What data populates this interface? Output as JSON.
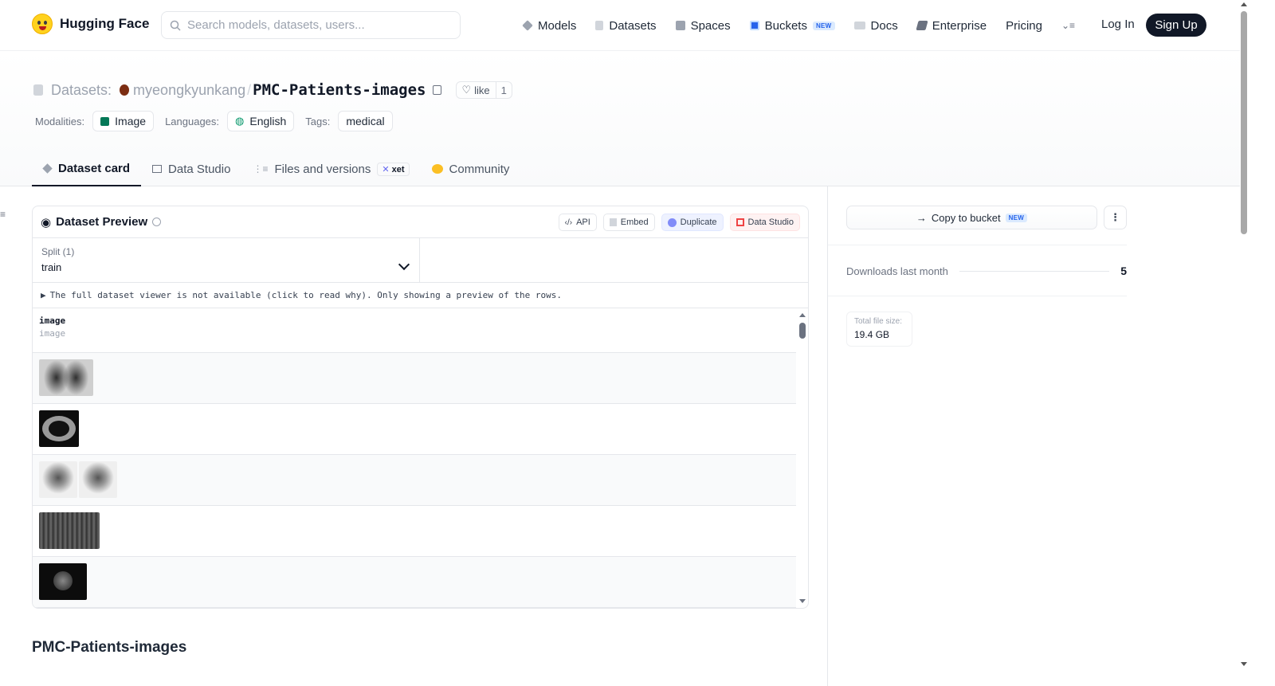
{
  "brand": {
    "name": "Hugging Face"
  },
  "search": {
    "placeholder": "Search models, datasets, users..."
  },
  "nav": {
    "items": [
      {
        "label": "Models",
        "color": "#9ca3af"
      },
      {
        "label": "Datasets",
        "color": "#d1d5db"
      },
      {
        "label": "Spaces",
        "color": "#9ca3af"
      },
      {
        "label": "Buckets",
        "color": "#2563eb",
        "badge": "NEW"
      },
      {
        "label": "Docs",
        "color": "#9ca3af"
      },
      {
        "label": "Enterprise",
        "color": "#6b7280"
      },
      {
        "label": "Pricing"
      }
    ],
    "login": "Log In",
    "signup": "Sign Up"
  },
  "repo": {
    "type_label": "Datasets:",
    "owner": "myeongkyunkang",
    "separator": "/",
    "name": "PMC-Patients-images",
    "like_label": "like",
    "like_count": "1"
  },
  "meta": {
    "modalities_label": "Modalities:",
    "modality": "Image",
    "languages_label": "Languages:",
    "language": "English",
    "tags_label": "Tags:",
    "tag": "medical"
  },
  "tabs": [
    {
      "label": "Dataset card",
      "active": true
    },
    {
      "label": "Data Studio"
    },
    {
      "label": "Files and versions",
      "badge": "xet"
    },
    {
      "label": "Community"
    }
  ],
  "preview": {
    "title": "Dataset Preview",
    "actions": {
      "api": "API",
      "embed": "Embed",
      "duplicate": "Duplicate",
      "data_studio": "Data Studio"
    },
    "split_label": "Split (1)",
    "split_value": "train",
    "notice": "The full dataset viewer is not available (click to read why). Only showing a preview of the rows.",
    "column": {
      "name": "image",
      "type": "image"
    },
    "row_count": 5
  },
  "readme": {
    "title": "PMC-Patients-images"
  },
  "sidebar": {
    "copy_bucket": "Copy to bucket",
    "copy_bucket_badge": "NEW",
    "downloads_label": "Downloads last month",
    "downloads_value": "5",
    "filesize_label": "Total file size:",
    "filesize_value": "19.4 GB"
  },
  "colors": {
    "accent": "#111827",
    "brand_yellow": "#ffd21e",
    "new_badge": "#2563eb"
  }
}
